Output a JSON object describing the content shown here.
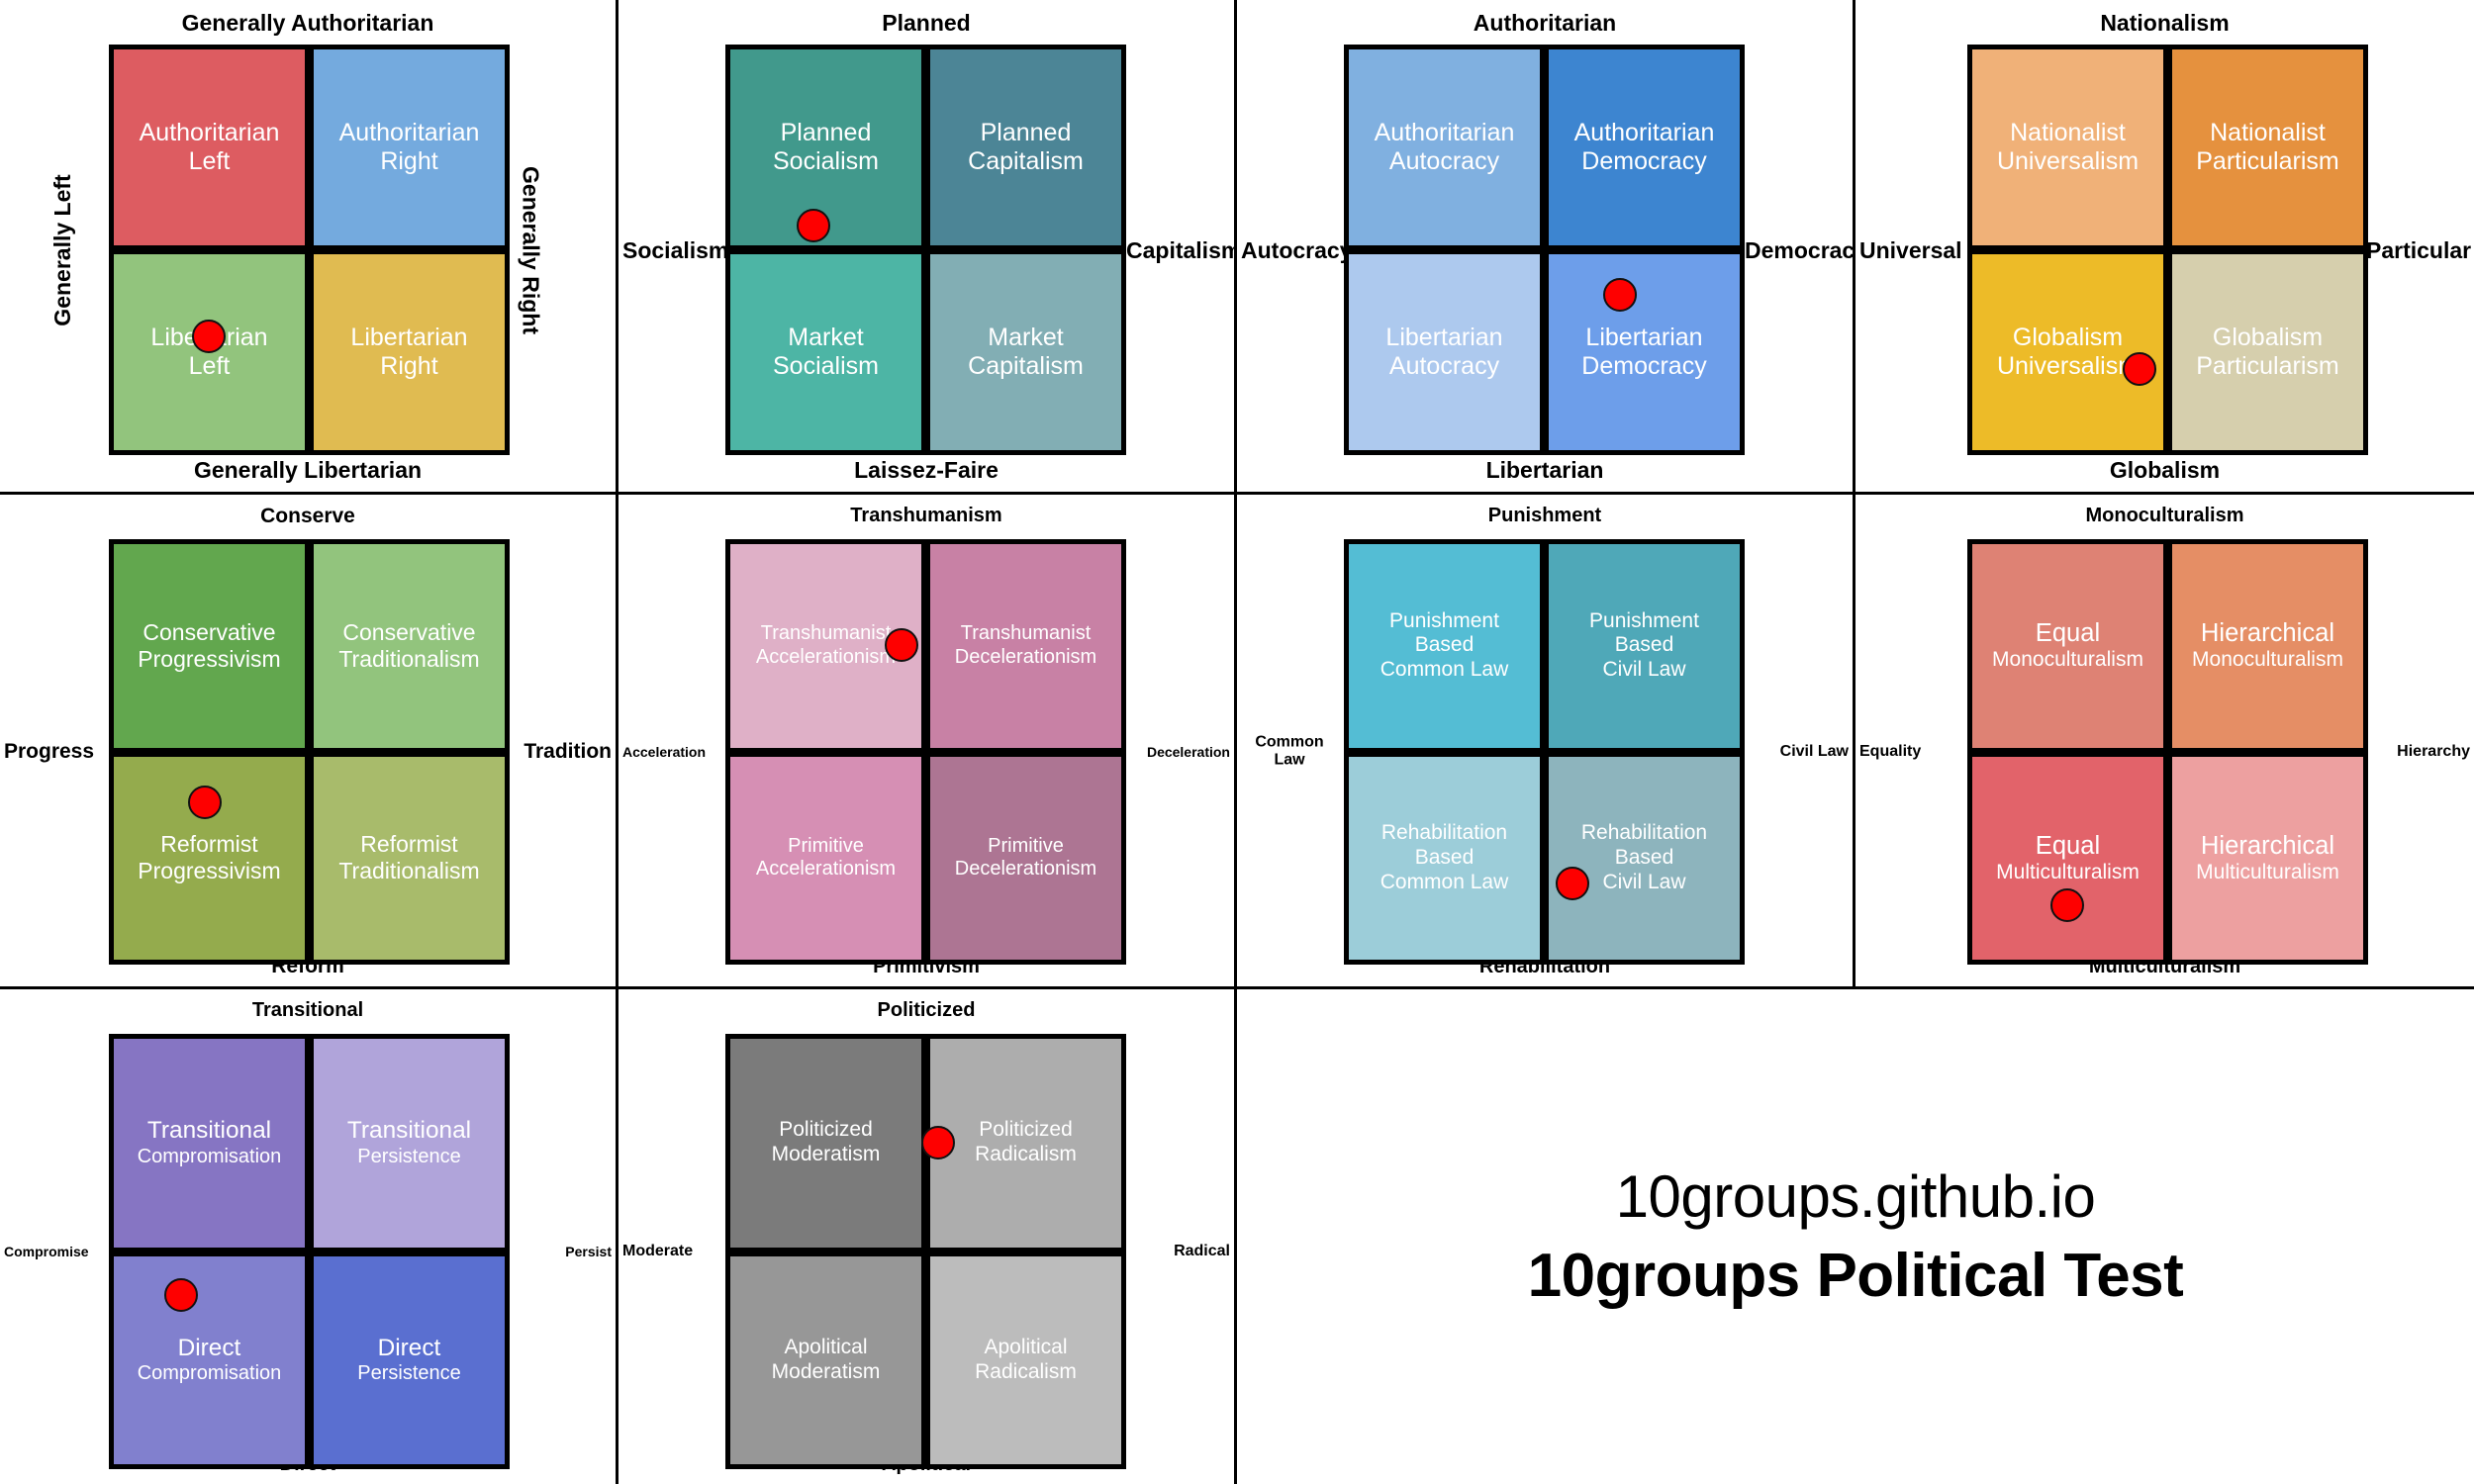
{
  "branding": {
    "site": "10groups.github.io",
    "title": "10groups Political Test"
  },
  "chart_data": {
    "type": "scatter",
    "description": "Ten 2x2 political-compass style quadrant charts, each with a single red marker indicating the respondent's position.",
    "axis_range": [
      -1,
      1
    ],
    "marker_color": "#fe0000",
    "grid": false,
    "legend": null,
    "charts": [
      {
        "id": "left-right-auth-lib",
        "top": "Generally Authoritarian",
        "bottom": "Generally Libertarian",
        "left": "Generally Left",
        "right": "Generally Right",
        "left_vertical": true,
        "right_vertical": true,
        "quadrants": [
          {
            "label": "Authoritarian Left",
            "l1": "Authoritarian",
            "l2": "Left",
            "color": "#dd5c61"
          },
          {
            "label": "Authoritarian Right",
            "l1": "Authoritarian",
            "l2": "Right",
            "color": "#74aade"
          },
          {
            "label": "Libertarian Left",
            "l1": "Libertarian",
            "l2": "Left",
            "color": "#92c47d"
          },
          {
            "label": "Libertarian Right",
            "l1": "Libertarian",
            "l2": "Right",
            "color": "#e0bb51"
          }
        ],
        "point": {
          "x": 0.245,
          "y": 0.705,
          "quadrant": "Libertarian Left"
        }
      },
      {
        "id": "planned-market",
        "top": "Planned",
        "bottom": "Laissez-Faire",
        "left": "Socialism",
        "right": "Capitalism",
        "quadrants": [
          {
            "label": "Planned Socialism",
            "l1": "Planned",
            "l2": "Socialism",
            "color": "#41998c"
          },
          {
            "label": "Planned Capitalism",
            "l1": "Planned",
            "l2": "Capitalism",
            "color": "#4c8596"
          },
          {
            "label": "Market Socialism",
            "l1": "Market",
            "l2": "Socialism",
            "color": "#4db5a5"
          },
          {
            "label": "Market Capitalism",
            "l1": "Market",
            "l2": "Capitalism",
            "color": "#82aeb4"
          }
        ],
        "point": {
          "x": 0.215,
          "y": 0.435,
          "quadrant": "Planned Socialism"
        }
      },
      {
        "id": "autocracy-democracy",
        "top": "Authoritarian",
        "bottom": "Libertarian",
        "left": "Autocracy",
        "right": "Democracy",
        "quadrants": [
          {
            "label": "Authoritarian Autocracy",
            "l1": "Authoritarian",
            "l2": "Autocracy",
            "color": "#80b0e0"
          },
          {
            "label": "Authoritarian Democracy",
            "l1": "Authoritarian",
            "l2": "Democracy",
            "color": "#3d85d0"
          },
          {
            "label": "Libertarian Autocracy",
            "l1": "Libertarian",
            "l2": "Autocracy",
            "color": "#adc9ee"
          },
          {
            "label": "Libertarian Democracy",
            "l1": "Libertarian",
            "l2": "Democracy",
            "color": "#6d9eea"
          }
        ],
        "point": {
          "x": 0.685,
          "y": 0.605,
          "quadrant": "Libertarian Democracy"
        }
      },
      {
        "id": "nationalism-globalism",
        "top": "Nationalism",
        "bottom": "Globalism",
        "left": "Universal",
        "right": "Particular",
        "quadrants": [
          {
            "label": "Nationalist Universalism",
            "l1": "Nationalist",
            "l2": "Universalism",
            "color": "#f0b178"
          },
          {
            "label": "Nationalist Particularism",
            "l1": "Nationalist",
            "l2": "Particularism",
            "color": "#e5913e"
          },
          {
            "label": "Globalism Universalism",
            "l1": "Globalism",
            "l2": "Universalism",
            "color": "#edbb28"
          },
          {
            "label": "Globalism Particularism",
            "l1": "Globalism",
            "l2": "Particularism",
            "color": "#d6cfad"
          }
        ],
        "point": {
          "x": 0.425,
          "y": 0.785,
          "quadrant": "Globalism Universalism"
        }
      },
      {
        "id": "conserve-reform",
        "top": "Conserve",
        "bottom": "Reform",
        "left": "Progress",
        "right": "Tradition",
        "quadrants": [
          {
            "label": "Conservative Progressivism",
            "l1": "Conservative",
            "l2": "Progressivism",
            "color": "#62a74e"
          },
          {
            "label": "Conservative Traditionalism",
            "l1": "Conservative",
            "l2": "Traditionalism",
            "color": "#92c47d"
          },
          {
            "label": "Reformist Progressivism",
            "l1": "Reformist",
            "l2": "Progressivism",
            "color": "#94ab4d"
          },
          {
            "label": "Reformist Traditionalism",
            "l1": "Reformist",
            "l2": "Traditionalism",
            "color": "#a8bb6b"
          }
        ],
        "point": {
          "x": 0.235,
          "y": 0.615,
          "quadrant": "Reformist Progressivism"
        }
      },
      {
        "id": "transhumanism-primitivism",
        "top": "Transhumanism",
        "bottom": "Primitivism",
        "left": "Acceleration",
        "right": "Deceleration",
        "quadrants": [
          {
            "label": "Transhumanist Accelerationism",
            "l1": "Transhumanist",
            "l2": "Accelerationism",
            "color": "#dfb0c7"
          },
          {
            "label": "Transhumanist Decelerationism",
            "l1": "Transhumanist",
            "l2": "Decelerationism",
            "color": "#c881a5"
          },
          {
            "label": "Primitive Accelerationism",
            "l1": "Primitive",
            "l2": "Accelerationism",
            "color": "#d68fb4"
          },
          {
            "label": "Primitive Decelerationism",
            "l1": "Primitive",
            "l2": "Decelerationism",
            "color": "#ad7593"
          }
        ],
        "point": {
          "x": 0.435,
          "y": 0.245,
          "quadrant": "Transhumanist Accelerationism"
        }
      },
      {
        "id": "punishment-rehabilitation",
        "top": "Punishment",
        "bottom": "Rehabilitation",
        "left": "Common Law",
        "right": "Civil Law",
        "quadrants": [
          {
            "label": "Punishment Based Common Law",
            "l1": "Punishment",
            "l2": "Based",
            "l3": "Common Law",
            "color": "#54bdd4"
          },
          {
            "label": "Punishment Based Civil Law",
            "l1": "Punishment",
            "l2": "Based",
            "l3": "Civil Law",
            "color": "#4fa8b8"
          },
          {
            "label": "Rehabilitation Based Common Law",
            "l1": "Rehabilitation",
            "l2": "Based",
            "l3": "Common Law",
            "color": "#9ccdd9"
          },
          {
            "label": "Rehabilitation Based Civil Law",
            "l1": "Rehabilitation",
            "l2": "Based",
            "l3": "Civil Law",
            "color": "#8db4bd"
          }
        ],
        "point": {
          "x": 0.565,
          "y": 0.805,
          "quadrant": "Rehabilitation Based Civil Law"
        }
      },
      {
        "id": "mono-multiculturalism",
        "top": "Monoculturalism",
        "bottom": "Multiculturalism",
        "left": "Equality",
        "right": "Hierarchy",
        "quadrants": [
          {
            "label": "Equal Monoculturalism",
            "l1": "Equal",
            "l2": "Monoculturalism",
            "color": "#de8274"
          },
          {
            "label": "Hierarchical Monoculturalism",
            "l1": "Hierarchical",
            "l2": "Monoculturalism",
            "color": "#e58e65"
          },
          {
            "label": "Equal Multiculturalism",
            "l1": "Equal",
            "l2": "Multiculturalism",
            "color": "#e2636a"
          },
          {
            "label": "Hierarchical Multiculturalism",
            "l1": "Hierarchical",
            "l2": "Multiculturalism",
            "color": "#eda0a0"
          }
        ],
        "point": {
          "x": 0.245,
          "y": 0.855,
          "quadrant": "Equal Multiculturalism"
        }
      },
      {
        "id": "transitional-direct",
        "top": "Transitional",
        "bottom": "Direct",
        "left": "Compromise",
        "right": "Persist",
        "quadrants": [
          {
            "label": "Transitional Compromisation",
            "l1": "Transitional",
            "l2": "Compromisation",
            "color": "#8675c3"
          },
          {
            "label": "Transitional Persistence",
            "l1": "Transitional",
            "l2": "Persistence",
            "color": "#b0a4da"
          },
          {
            "label": "Direct Compromisation",
            "l1": "Direct",
            "l2": "Compromisation",
            "color": "#8180ce"
          },
          {
            "label": "Direct Persistence",
            "l1": "Direct",
            "l2": "Persistence",
            "color": "#5a6fd0"
          }
        ],
        "point": {
          "x": 0.175,
          "y": 0.595,
          "quadrant": "Direct Compromisation"
        }
      },
      {
        "id": "politicized-apolitical",
        "top": "Politicized",
        "bottom": "Apolitical",
        "left": "Moderate",
        "right": "Radical",
        "quadrants": [
          {
            "label": "Politicized Moderatism",
            "l1": "Politicized",
            "l2": "Moderatism",
            "color": "#7b7b7b"
          },
          {
            "label": "Politicized Radicalism",
            "l1": "Politicized",
            "l2": "Radicalism",
            "color": "#adadad"
          },
          {
            "label": "Apolitical Moderatism",
            "l1": "Apolitical",
            "l2": "Moderatism",
            "color": "#979797"
          },
          {
            "label": "Apolitical Radicalism",
            "l1": "Apolitical",
            "l2": "Radicalism",
            "color": "#bcbcbc"
          }
        ],
        "point": {
          "x": 0.525,
          "y": 0.245,
          "quadrant": "Politicized Radicalism"
        }
      }
    ]
  }
}
